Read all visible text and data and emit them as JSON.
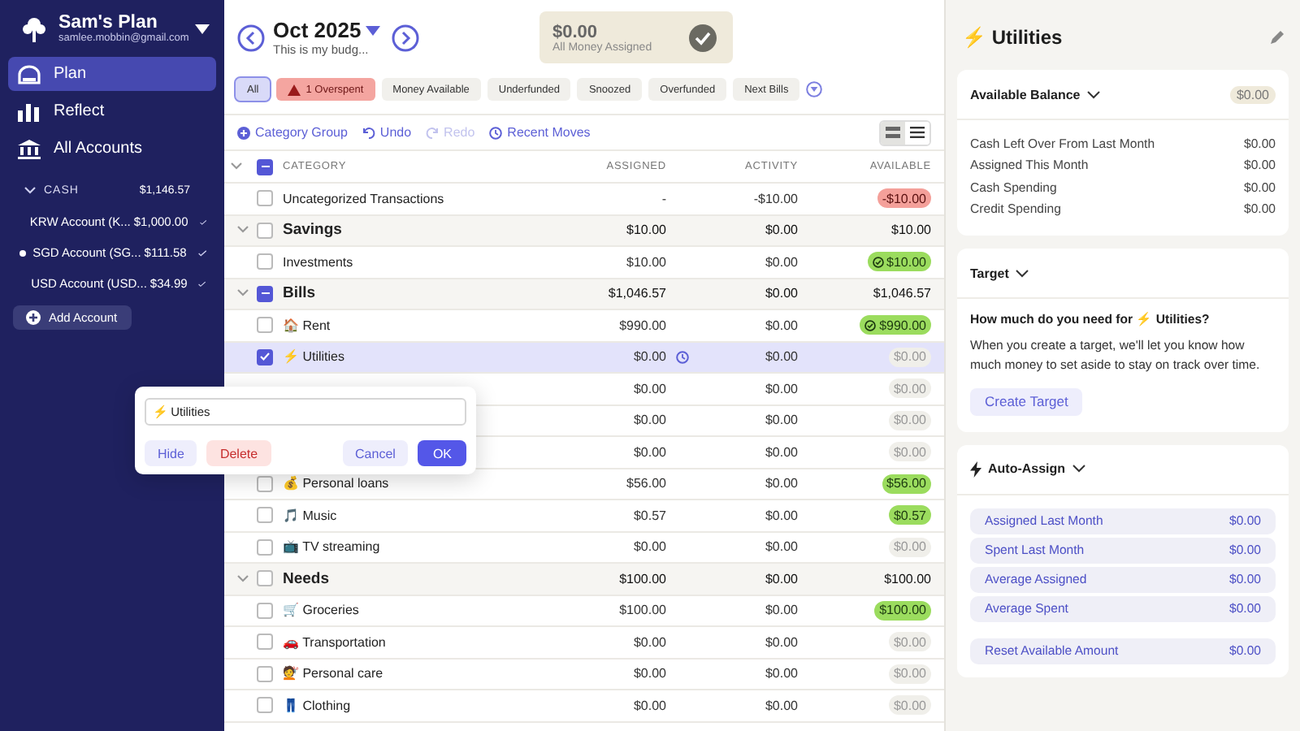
{
  "sidebar": {
    "plan_name": "Sam's Plan",
    "email": "samlee.mobbin@gmail.com",
    "nav": [
      {
        "kind": "plan",
        "label": "Plan",
        "selected": true
      },
      {
        "kind": "reflect",
        "label": "Reflect",
        "selected": false
      },
      {
        "kind": "accounts",
        "label": "All Accounts",
        "selected": false
      }
    ],
    "account_group": {
      "label": "CASH",
      "total": "$1,146.57",
      "expanded": true
    },
    "accounts": [
      {
        "name": "KRW Account (K...",
        "balance": "$1,000.00",
        "dot": false
      },
      {
        "name": "SGD Account (SG...",
        "balance": "$111.58",
        "dot": true
      },
      {
        "name": "USD Account (USD...",
        "balance": "$34.99",
        "dot": false
      }
    ],
    "add_account": "Add Account"
  },
  "header": {
    "month": "Oct 2025",
    "note": "This is my budg...",
    "to_assign": {
      "amount": "$0.00",
      "label": "All Money Assigned"
    }
  },
  "filters": [
    {
      "label": "All",
      "kind": "plain",
      "selected": true
    },
    {
      "label": "1 Overspent",
      "kind": "warning",
      "selected": false
    },
    {
      "label": "Money Available",
      "kind": "plain",
      "selected": false
    },
    {
      "label": "Underfunded",
      "kind": "plain",
      "selected": false
    },
    {
      "label": "Snoozed",
      "kind": "plain",
      "selected": false
    },
    {
      "label": "Overfunded",
      "kind": "plain",
      "selected": false
    },
    {
      "label": "Next Bills",
      "kind": "plain",
      "selected": false
    }
  ],
  "toolbar": [
    {
      "kind": "add",
      "label": "Category Group",
      "disabled": false
    },
    {
      "kind": "undo",
      "label": "Undo",
      "disabled": false
    },
    {
      "kind": "redo",
      "label": "Redo",
      "disabled": true
    },
    {
      "kind": "history",
      "label": "Recent Moves",
      "disabled": false
    }
  ],
  "view_toggle": [
    {
      "kind": "compact",
      "selected": true
    },
    {
      "kind": "list",
      "selected": false
    }
  ],
  "table": {
    "columns": [
      "CATEGORY",
      "ASSIGNED",
      "ACTIVITY",
      "AVAILABLE"
    ],
    "header_checked": true,
    "header_mixed": true,
    "rows": [
      {
        "kind": "category",
        "name": "Uncategorized Transactions",
        "checked": false,
        "selected": false,
        "assigned": "-",
        "activity": "-$10.00",
        "available": {
          "kind": "overspent",
          "text": "-$10.00"
        }
      },
      {
        "kind": "group",
        "name": "Savings",
        "checked": false,
        "mixed": false,
        "selected": false,
        "expanded": true,
        "assigned": "$10.00",
        "activity": "$0.00",
        "available": {
          "kind": "plain",
          "text": "$10.00"
        }
      },
      {
        "kind": "category",
        "name": "Investments",
        "checked": false,
        "selected": false,
        "assigned": "$10.00",
        "activity": "$0.00",
        "available": {
          "kind": "funded",
          "text": "$10.00"
        }
      },
      {
        "kind": "group",
        "name": "Bills",
        "checked": true,
        "mixed": true,
        "selected": false,
        "expanded": true,
        "assigned": "$1,046.57",
        "activity": "$0.00",
        "available": {
          "kind": "plain",
          "text": "$1,046.57"
        }
      },
      {
        "kind": "category",
        "name": "🏠 Rent",
        "checked": false,
        "selected": false,
        "assigned": "$990.00",
        "activity": "$0.00",
        "available": {
          "kind": "funded",
          "text": "$990.00"
        }
      },
      {
        "kind": "category",
        "name": "⚡ Utilities",
        "checked": true,
        "selected": true,
        "assigned": "$0.00",
        "activity": "$0.00",
        "available": {
          "kind": "zero",
          "text": "$0.00"
        }
      },
      {
        "kind": "category",
        "selected": false,
        "assigned": "$0.00",
        "activity": "$0.00",
        "available": {
          "kind": "zero",
          "text": "$0.00"
        }
      },
      {
        "kind": "category",
        "selected": false,
        "assigned": "$0.00",
        "activity": "$0.00",
        "available": {
          "kind": "zero",
          "text": "$0.00"
        }
      },
      {
        "kind": "category",
        "selected": false,
        "assigned": "$0.00",
        "activity": "$0.00",
        "available": {
          "kind": "zero",
          "text": "$0.00"
        }
      },
      {
        "kind": "category",
        "name": "💰 Personal loans",
        "checked": false,
        "selected": false,
        "assigned": "$56.00",
        "activity": "$0.00",
        "available": {
          "kind": "positive",
          "text": "$56.00"
        }
      },
      {
        "kind": "category",
        "name": "🎵 Music",
        "checked": false,
        "selected": false,
        "assigned": "$0.57",
        "activity": "$0.00",
        "available": {
          "kind": "positive",
          "text": "$0.57"
        }
      },
      {
        "kind": "category",
        "name": "📺 TV streaming",
        "checked": false,
        "selected": false,
        "assigned": "$0.00",
        "activity": "$0.00",
        "available": {
          "kind": "zero",
          "text": "$0.00"
        }
      },
      {
        "kind": "group",
        "name": "Needs",
        "checked": false,
        "mixed": false,
        "selected": false,
        "expanded": true,
        "assigned": "$100.00",
        "activity": "$0.00",
        "available": {
          "kind": "plain",
          "text": "$100.00"
        }
      },
      {
        "kind": "category",
        "name": "🛒 Groceries",
        "checked": false,
        "selected": false,
        "assigned": "$100.00",
        "activity": "$0.00",
        "available": {
          "kind": "positive",
          "text": "$100.00"
        }
      },
      {
        "kind": "category",
        "name": "🚗 Transportation",
        "checked": false,
        "selected": false,
        "assigned": "$0.00",
        "activity": "$0.00",
        "available": {
          "kind": "zero",
          "text": "$0.00"
        }
      },
      {
        "kind": "category",
        "name": "💇 Personal care",
        "checked": false,
        "selected": false,
        "assigned": "$0.00",
        "activity": "$0.00",
        "available": {
          "kind": "zero",
          "text": "$0.00"
        }
      },
      {
        "kind": "category",
        "name": "👖 Clothing",
        "checked": false,
        "selected": false,
        "assigned": "$0.00",
        "activity": "$0.00",
        "available": {
          "kind": "zero",
          "text": "$0.00"
        }
      }
    ]
  },
  "popover": {
    "value": "⚡ Utilities",
    "buttons": [
      {
        "kind": "secondary",
        "label": "Hide"
      },
      {
        "kind": "danger",
        "label": "Delete"
      },
      {
        "kind": "secondary",
        "label": "Cancel"
      },
      {
        "kind": "primary",
        "label": "OK"
      }
    ]
  },
  "inspector": {
    "title": "⚡ Utilities",
    "balance": {
      "title": "Available Balance",
      "amount": "$0.00",
      "rows": [
        {
          "label": "Cash Left Over From Last Month",
          "value": "$0.00"
        },
        {
          "label": "Assigned This Month",
          "value": "$0.00"
        },
        {
          "label": "Cash Spending",
          "value": "$0.00"
        },
        {
          "label": "Credit Spending",
          "value": "$0.00"
        }
      ]
    },
    "target": {
      "title": "Target",
      "question": "How much do you need for ⚡ Utilities?",
      "text": "When you create a target, we'll let you know how much money to set aside to stay on track over time.",
      "button": "Create Target"
    },
    "auto_assign": {
      "title": "Auto-Assign",
      "rows": [
        {
          "label": "Assigned Last Month",
          "value": "$0.00"
        },
        {
          "label": "Spent Last Month",
          "value": "$0.00"
        },
        {
          "label": "Average Assigned",
          "value": "$0.00"
        },
        {
          "label": "Average Spent",
          "value": "$0.00"
        }
      ],
      "reset": {
        "label": "Reset Available Amount",
        "value": "$0.00"
      }
    }
  }
}
